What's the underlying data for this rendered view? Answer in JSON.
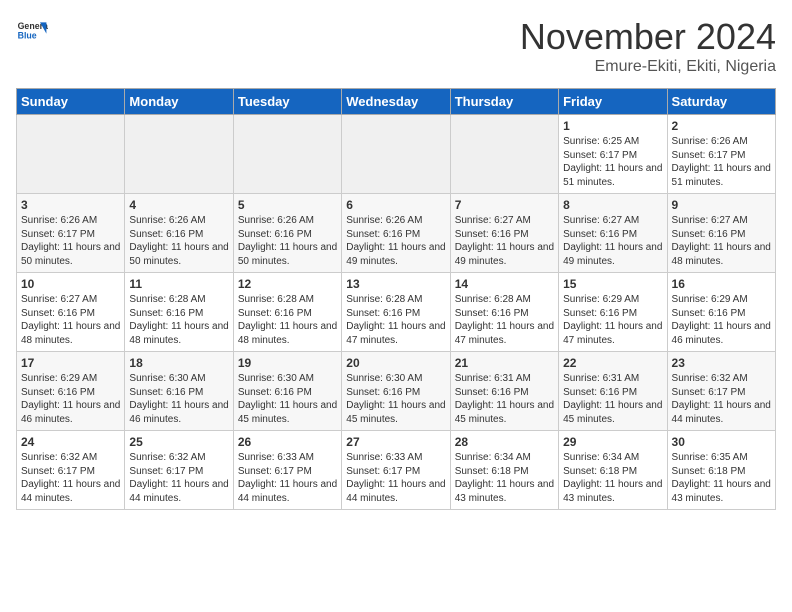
{
  "header": {
    "logo_general": "General",
    "logo_blue": "Blue",
    "month_title": "November 2024",
    "subtitle": "Emure-Ekiti, Ekiti, Nigeria"
  },
  "weekdays": [
    "Sunday",
    "Monday",
    "Tuesday",
    "Wednesday",
    "Thursday",
    "Friday",
    "Saturday"
  ],
  "weeks": [
    [
      {
        "day": "",
        "info": ""
      },
      {
        "day": "",
        "info": ""
      },
      {
        "day": "",
        "info": ""
      },
      {
        "day": "",
        "info": ""
      },
      {
        "day": "",
        "info": ""
      },
      {
        "day": "1",
        "info": "Sunrise: 6:25 AM\nSunset: 6:17 PM\nDaylight: 11 hours and 51 minutes."
      },
      {
        "day": "2",
        "info": "Sunrise: 6:26 AM\nSunset: 6:17 PM\nDaylight: 11 hours and 51 minutes."
      }
    ],
    [
      {
        "day": "3",
        "info": "Sunrise: 6:26 AM\nSunset: 6:17 PM\nDaylight: 11 hours and 50 minutes."
      },
      {
        "day": "4",
        "info": "Sunrise: 6:26 AM\nSunset: 6:16 PM\nDaylight: 11 hours and 50 minutes."
      },
      {
        "day": "5",
        "info": "Sunrise: 6:26 AM\nSunset: 6:16 PM\nDaylight: 11 hours and 50 minutes."
      },
      {
        "day": "6",
        "info": "Sunrise: 6:26 AM\nSunset: 6:16 PM\nDaylight: 11 hours and 49 minutes."
      },
      {
        "day": "7",
        "info": "Sunrise: 6:27 AM\nSunset: 6:16 PM\nDaylight: 11 hours and 49 minutes."
      },
      {
        "day": "8",
        "info": "Sunrise: 6:27 AM\nSunset: 6:16 PM\nDaylight: 11 hours and 49 minutes."
      },
      {
        "day": "9",
        "info": "Sunrise: 6:27 AM\nSunset: 6:16 PM\nDaylight: 11 hours and 48 minutes."
      }
    ],
    [
      {
        "day": "10",
        "info": "Sunrise: 6:27 AM\nSunset: 6:16 PM\nDaylight: 11 hours and 48 minutes."
      },
      {
        "day": "11",
        "info": "Sunrise: 6:28 AM\nSunset: 6:16 PM\nDaylight: 11 hours and 48 minutes."
      },
      {
        "day": "12",
        "info": "Sunrise: 6:28 AM\nSunset: 6:16 PM\nDaylight: 11 hours and 48 minutes."
      },
      {
        "day": "13",
        "info": "Sunrise: 6:28 AM\nSunset: 6:16 PM\nDaylight: 11 hours and 47 minutes."
      },
      {
        "day": "14",
        "info": "Sunrise: 6:28 AM\nSunset: 6:16 PM\nDaylight: 11 hours and 47 minutes."
      },
      {
        "day": "15",
        "info": "Sunrise: 6:29 AM\nSunset: 6:16 PM\nDaylight: 11 hours and 47 minutes."
      },
      {
        "day": "16",
        "info": "Sunrise: 6:29 AM\nSunset: 6:16 PM\nDaylight: 11 hours and 46 minutes."
      }
    ],
    [
      {
        "day": "17",
        "info": "Sunrise: 6:29 AM\nSunset: 6:16 PM\nDaylight: 11 hours and 46 minutes."
      },
      {
        "day": "18",
        "info": "Sunrise: 6:30 AM\nSunset: 6:16 PM\nDaylight: 11 hours and 46 minutes."
      },
      {
        "day": "19",
        "info": "Sunrise: 6:30 AM\nSunset: 6:16 PM\nDaylight: 11 hours and 45 minutes."
      },
      {
        "day": "20",
        "info": "Sunrise: 6:30 AM\nSunset: 6:16 PM\nDaylight: 11 hours and 45 minutes."
      },
      {
        "day": "21",
        "info": "Sunrise: 6:31 AM\nSunset: 6:16 PM\nDaylight: 11 hours and 45 minutes."
      },
      {
        "day": "22",
        "info": "Sunrise: 6:31 AM\nSunset: 6:16 PM\nDaylight: 11 hours and 45 minutes."
      },
      {
        "day": "23",
        "info": "Sunrise: 6:32 AM\nSunset: 6:17 PM\nDaylight: 11 hours and 44 minutes."
      }
    ],
    [
      {
        "day": "24",
        "info": "Sunrise: 6:32 AM\nSunset: 6:17 PM\nDaylight: 11 hours and 44 minutes."
      },
      {
        "day": "25",
        "info": "Sunrise: 6:32 AM\nSunset: 6:17 PM\nDaylight: 11 hours and 44 minutes."
      },
      {
        "day": "26",
        "info": "Sunrise: 6:33 AM\nSunset: 6:17 PM\nDaylight: 11 hours and 44 minutes."
      },
      {
        "day": "27",
        "info": "Sunrise: 6:33 AM\nSunset: 6:17 PM\nDaylight: 11 hours and 44 minutes."
      },
      {
        "day": "28",
        "info": "Sunrise: 6:34 AM\nSunset: 6:18 PM\nDaylight: 11 hours and 43 minutes."
      },
      {
        "day": "29",
        "info": "Sunrise: 6:34 AM\nSunset: 6:18 PM\nDaylight: 11 hours and 43 minutes."
      },
      {
        "day": "30",
        "info": "Sunrise: 6:35 AM\nSunset: 6:18 PM\nDaylight: 11 hours and 43 minutes."
      }
    ]
  ]
}
